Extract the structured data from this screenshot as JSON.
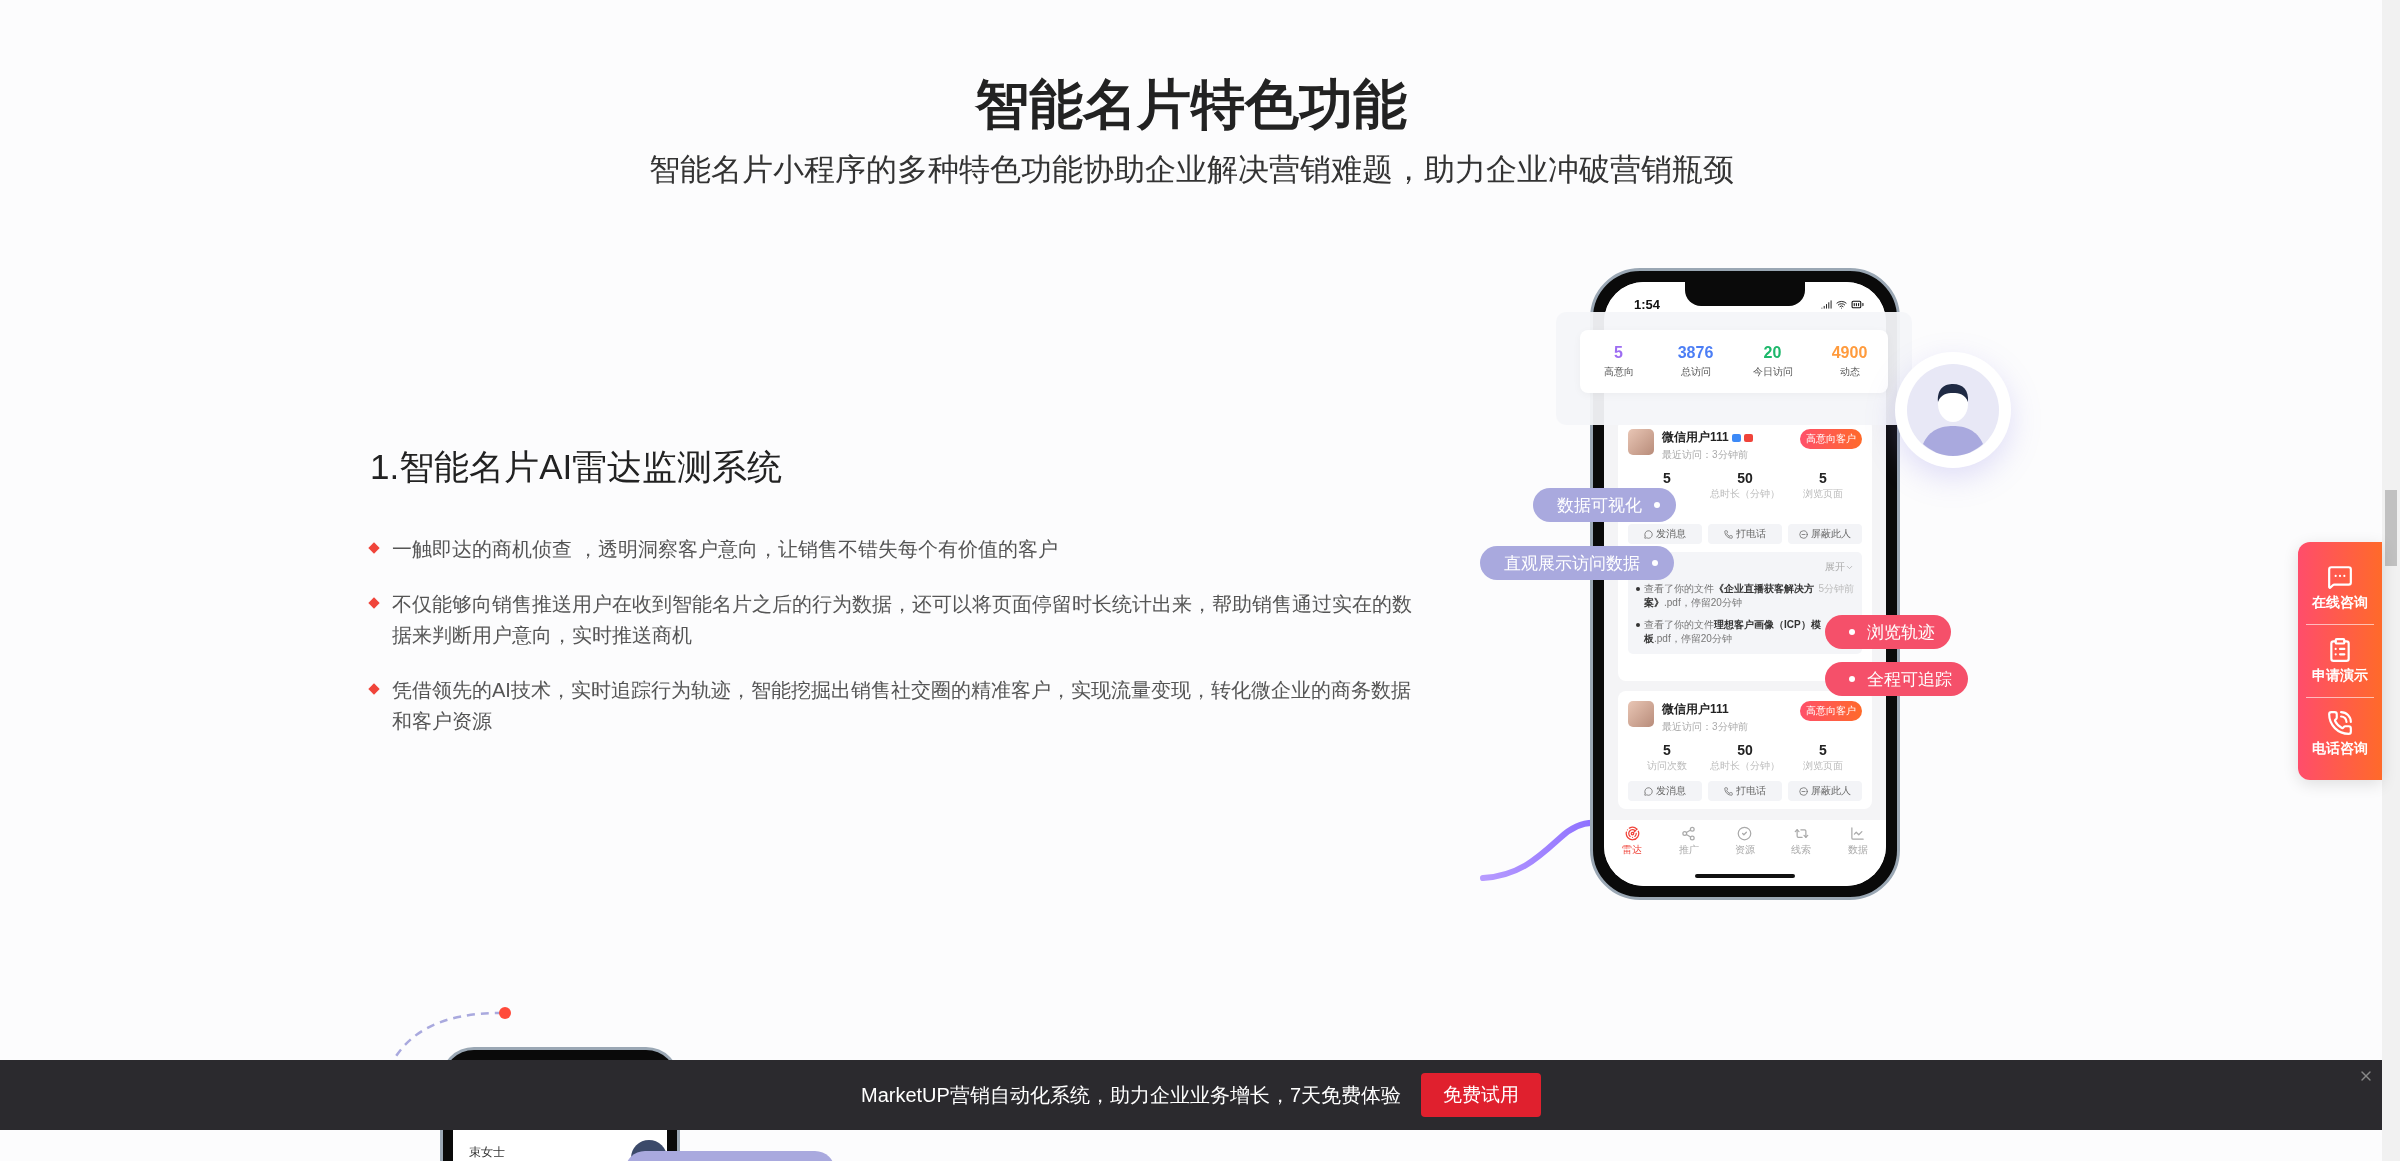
{
  "header": {
    "title": "智能名片特色功能",
    "subtitle": "智能名片小程序的多种特色功能协助企业解决营销难题，助力企业冲破营销瓶颈"
  },
  "feature": {
    "heading": "1.智能名片AI雷达监测系统",
    "bullets": [
      "一触即达的商机侦查 ，透明洞察客户意向，让销售不错失每个有价值的客户",
      "不仅能够向销售推送用户在收到智能名片之后的行为数据，还可以将页面停留时长统计出来，帮助销售通过实在的数据来判断用户意向，实时推送商机",
      "凭借领先的AI技术，实时追踪行为轨迹，智能挖掘出销售社交圈的精准客户，实现流量变现，转化微企业的商务数据和客户资源"
    ]
  },
  "phone": {
    "time": "1:54",
    "stats": [
      {
        "value": "5",
        "label": "高意向",
        "color": "#9d6df2"
      },
      {
        "value": "3876",
        "label": "总访问",
        "color": "#4c7ef5"
      },
      {
        "value": "20",
        "label": "今日访问",
        "color": "#1db86b"
      },
      {
        "value": "4900",
        "label": "动态",
        "color": "#ff9b3d"
      }
    ],
    "cards": [
      {
        "name": "微信用户111",
        "tag_icons": true,
        "last_visit": "最近访问：3分钟前",
        "tag": "高意向客户",
        "stats": [
          {
            "value": "5"
          },
          {
            "value": "50",
            "label": "总时长（分钟）"
          },
          {
            "value": "5",
            "label": "浏览页面"
          }
        ],
        "actions": [
          "发消息",
          "打电话",
          "屏蔽此人"
        ],
        "activity": {
          "toggle": "展开",
          "items": [
            {
              "text": "查看了你的文件**《企业直播获客解决方案》**.pdf，停留20分钟",
              "time": "5分钟前"
            },
            {
              "text": "查看了你的文件**理想客户画像（ICP）模板**.pdf，停留20分钟"
            }
          ]
        }
      },
      {
        "name": "微信用户111",
        "tag_icons": false,
        "last_visit": "最近访问：3分钟前",
        "tag": "高意向客户",
        "stats": [
          {
            "value": "5",
            "label": "访问次数"
          },
          {
            "value": "50",
            "label": "总时长（分钟）"
          },
          {
            "value": "5",
            "label": "浏览页面"
          }
        ],
        "actions": [
          "发消息",
          "打电话",
          "屏蔽此人"
        ]
      }
    ],
    "tabs": [
      {
        "label": "雷达",
        "selected": true
      },
      {
        "label": "推广",
        "selected": false
      },
      {
        "label": "资源",
        "selected": false
      },
      {
        "label": "线索",
        "selected": false
      },
      {
        "label": "数据",
        "selected": false
      }
    ]
  },
  "callouts": [
    {
      "text": "数据可视化",
      "kind": "note"
    },
    {
      "text": "直观展示访问数据",
      "kind": "note"
    },
    {
      "text": "浏览轨迹",
      "kind": "highlight"
    },
    {
      "text": "全程可追踪",
      "kind": "highlight"
    }
  ],
  "next_section": {
    "contact_name": "束女士"
  },
  "side_menu": [
    {
      "label": "在线咨询",
      "kind": "chat"
    },
    {
      "label": "申请演示",
      "kind": "clipboard"
    },
    {
      "label": "电话咨询",
      "kind": "phone"
    }
  ],
  "banner": {
    "text": "MarketUP营销自动化系统，助力企业业务增长，7天免费体验",
    "button": "免费试用"
  }
}
